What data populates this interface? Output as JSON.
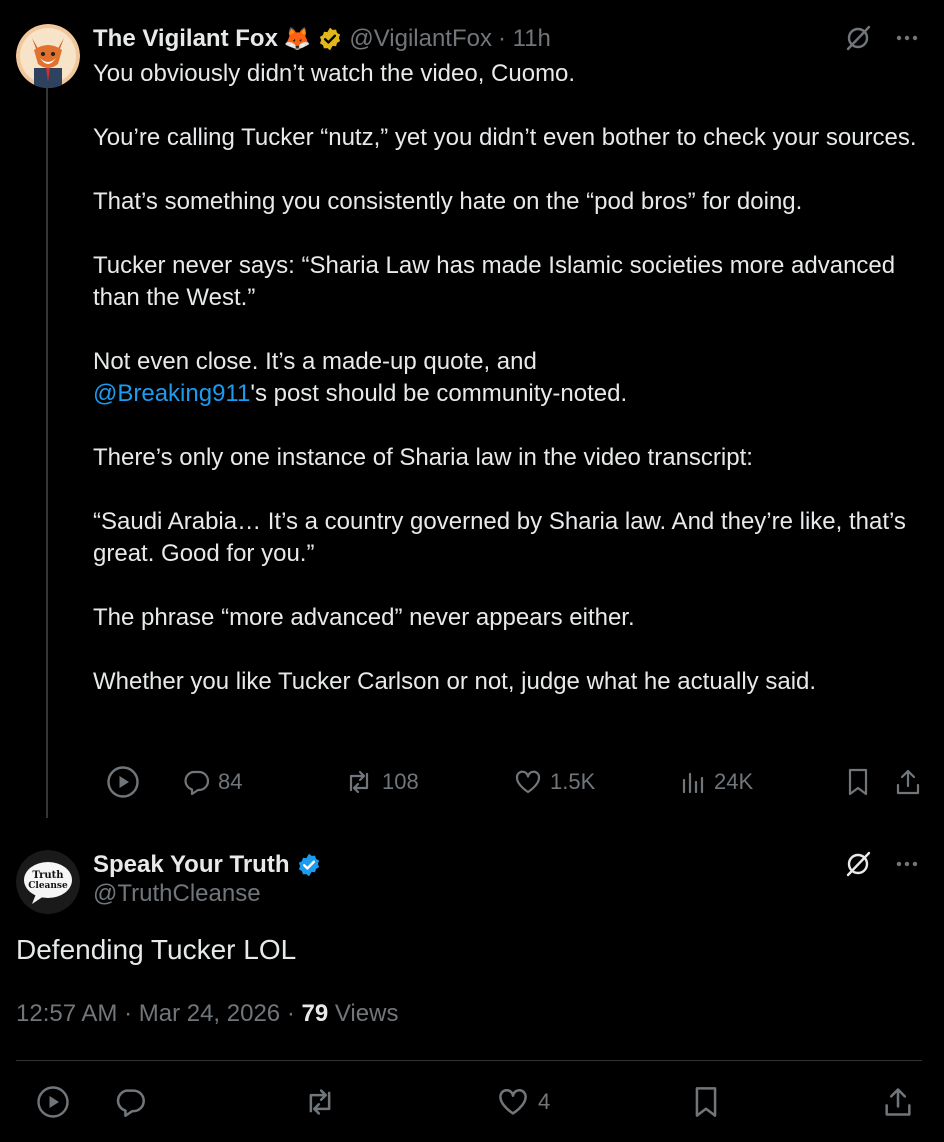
{
  "post1": {
    "author_name": "The Vigilant Fox",
    "author_emoji": "🦊",
    "handle": "@VigilantFox",
    "time": "· 11h",
    "paragraphs": [
      "You obviously didn’t watch the video, Cuomo.",
      "You’re calling Tucker “nutz,” yet you didn’t even bother to check your sources.",
      "That’s something you consistently hate on the “pod bros” for doing.",
      "Tucker never says: “Sharia Law has made Islamic societies more advanced than the West.”",
      "There’s only one instance of Sharia law in the video transcript:",
      "“Saudi Arabia… It’s a country governed by Sharia law. And they’re like, that’s great. Good for you.”",
      "The phrase “more advanced” never appears either.",
      "Whether you like Tucker Carlson or not, judge what he actually said."
    ],
    "quote_line_before": "Not even close. It’s a made-up quote, and",
    "mention": "@Breaking911",
    "quote_line_after": "'s post should be community-noted.",
    "stats": {
      "replies": "84",
      "reposts": "108",
      "likes": "1.5K",
      "views": "24K"
    }
  },
  "post2": {
    "author_name": "Speak Your Truth",
    "handle": "@TruthCleanse",
    "avatar_text_line1": "Truth",
    "avatar_text_line2": "Cleanse",
    "text": "Defending Tucker LOL",
    "timestamp": "12:57 AM · Mar 24, 2026 ·",
    "views_count": "79",
    "views_label": "Views",
    "likes": "4"
  },
  "colors": {
    "background": "#000000",
    "text": "#e7e9ea",
    "muted": "#71767b",
    "link": "#1d9bf0",
    "gold_badge": "#e2b719",
    "blue_badge": "#1d9bf0"
  }
}
